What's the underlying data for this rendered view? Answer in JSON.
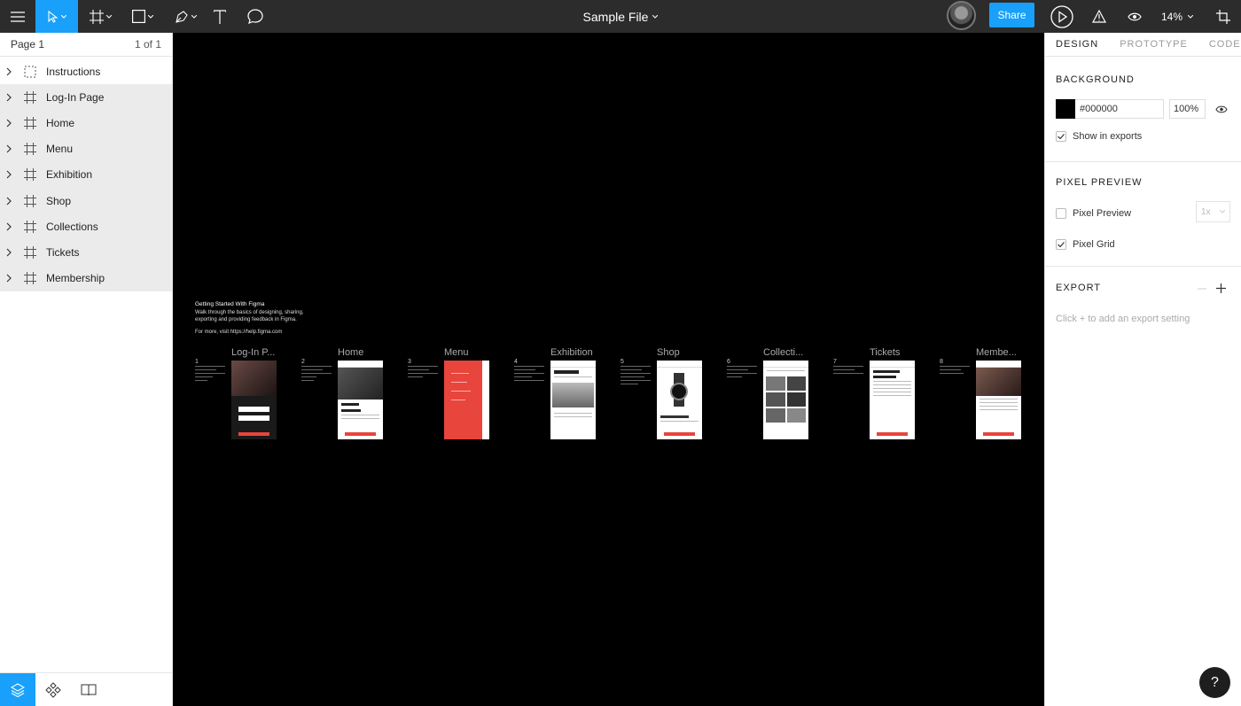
{
  "toolbar": {
    "file_title": "Sample File",
    "share_label": "Share",
    "zoom_level": "14%"
  },
  "left_panel": {
    "page_name": "Page 1",
    "page_count": "1 of 1",
    "layers": [
      {
        "label": "Instructions",
        "selected": false
      },
      {
        "label": "Log-In Page",
        "selected": true
      },
      {
        "label": "Home",
        "selected": true
      },
      {
        "label": "Menu",
        "selected": true
      },
      {
        "label": "Exhibition",
        "selected": true
      },
      {
        "label": "Shop",
        "selected": true
      },
      {
        "label": "Collections",
        "selected": true
      },
      {
        "label": "Tickets",
        "selected": true
      },
      {
        "label": "Membership",
        "selected": true
      }
    ]
  },
  "canvas": {
    "intro_title": "Getting Started With Figma",
    "intro_line1": "Walk through the basics of designing, sharing,",
    "intro_line2": "exporting and providing feedback in Figma.",
    "intro_link": "For more, visit https://help.figma.com",
    "frames": [
      {
        "num": "1",
        "label": "Log-In P..."
      },
      {
        "num": "2",
        "label": "Home"
      },
      {
        "num": "3",
        "label": "Menu"
      },
      {
        "num": "4",
        "label": "Exhibition"
      },
      {
        "num": "5",
        "label": "Shop"
      },
      {
        "num": "6",
        "label": "Collecti..."
      },
      {
        "num": "7",
        "label": "Tickets"
      },
      {
        "num": "8",
        "label": "Membe..."
      }
    ]
  },
  "right_panel": {
    "tabs": [
      "DESIGN",
      "PROTOTYPE",
      "CODE"
    ],
    "background_title": "BACKGROUND",
    "bg_color": "#000000",
    "bg_hex": "#000000",
    "bg_opacity": "100%",
    "show_in_exports": "Show in exports",
    "pixel_preview_title": "PIXEL PREVIEW",
    "pixel_preview_label": "Pixel Preview",
    "pixel_preview_scale": "1x",
    "pixel_grid_label": "Pixel Grid",
    "export_title": "EXPORT",
    "export_hint": "Click + to add an export setting"
  },
  "help_label": "?",
  "colors": {
    "accent": "#18a0fb",
    "toolbar": "#2c2c2c",
    "red": "#e8453c"
  }
}
